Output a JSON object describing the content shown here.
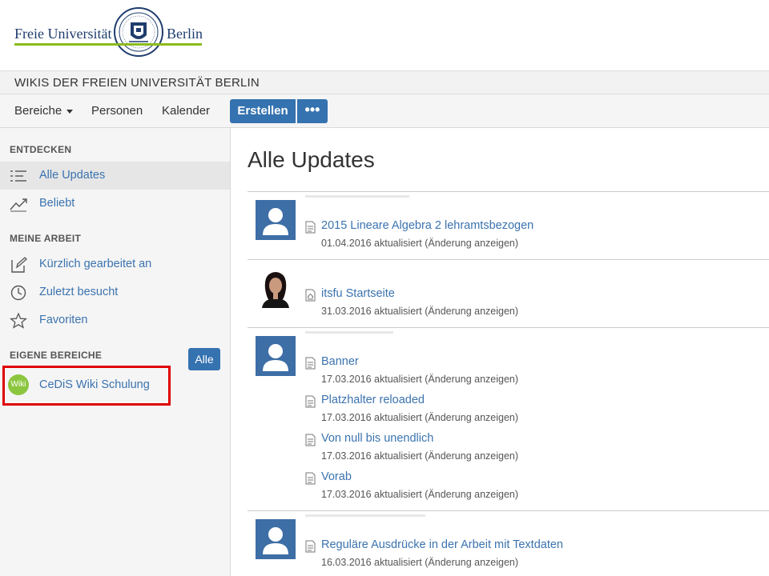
{
  "logo": {
    "left_text": "Freie Universität",
    "right_text": "Berlin",
    "seal_icon": "fu-berlin-seal-icon",
    "underline_color": "#8dba1e",
    "brand_color": "#1f3d6e"
  },
  "site": {
    "title": "WIKIS DER FREIEN UNIVERSITÄT BERLIN"
  },
  "nav": {
    "bereiche": "Bereiche",
    "personen": "Personen",
    "kalender": "Kalender",
    "create": "Erstellen",
    "more": "•••",
    "accent": "#3572b0"
  },
  "sidebar": {
    "entdecken_head": "ENTDECKEN",
    "alle_updates": "Alle Updates",
    "beliebt": "Beliebt",
    "meine_arbeit_head": "MEINE ARBEIT",
    "kuerzlich": "Kürzlich gearbeitet an",
    "zuletzt": "Zuletzt besucht",
    "favoriten": "Favoriten",
    "eigene_head": "EIGENE BEREICHE",
    "alle_button": "Alle",
    "space_avatar": "Wiki",
    "space_name": "CeDiS Wiki Schulung"
  },
  "main": {
    "title": "Alle Updates",
    "updates": [
      {
        "entries": [
          {
            "title": "2015 Lineare Algebra 2 lehramtsbezogen",
            "date": "01.04.2016 aktualisiert",
            "link": "(Änderung anzeigen)",
            "icon": "page-icon"
          }
        ]
      },
      {
        "entries": [
          {
            "title": "itsfu Startseite",
            "date": "31.03.2016 aktualisiert",
            "link": "(Änderung anzeigen)",
            "icon": "home-page-icon"
          }
        ]
      },
      {
        "entries": [
          {
            "title": "Banner",
            "date": "17.03.2016 aktualisiert",
            "link": "(Änderung anzeigen)",
            "icon": "page-icon"
          },
          {
            "title": "Platzhalter reloaded",
            "date": "17.03.2016 aktualisiert",
            "link": "(Änderung anzeigen)",
            "icon": "page-icon"
          },
          {
            "title": "Von null bis unendlich",
            "date": "17.03.2016 aktualisiert",
            "link": "(Änderung anzeigen)",
            "icon": "page-icon"
          },
          {
            "title": "Vorab",
            "date": "17.03.2016 aktualisiert",
            "link": "(Änderung anzeigen)",
            "icon": "page-icon"
          }
        ]
      },
      {
        "entries": [
          {
            "title": "Reguläre Ausdrücke in der Arbeit mit Textdaten",
            "date": "16.03.2016 aktualisiert",
            "link": "(Änderung anzeigen)",
            "icon": "page-icon"
          }
        ]
      }
    ]
  }
}
